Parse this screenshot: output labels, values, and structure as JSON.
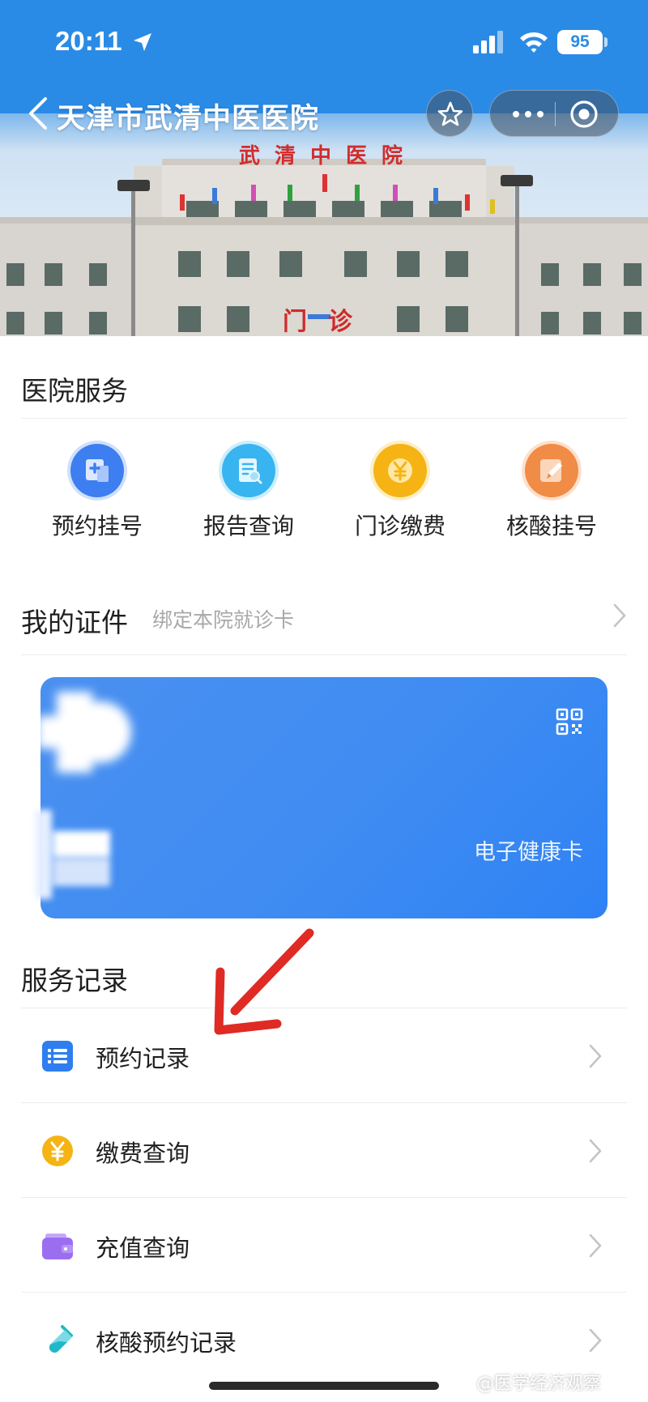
{
  "status_bar": {
    "time": "20:11",
    "battery": "95"
  },
  "nav": {
    "title": "天津市武清中医医院"
  },
  "hero": {
    "sign": "武清中医院",
    "door": "门诊"
  },
  "hospital_services": {
    "title": "医院服务",
    "items": [
      {
        "label": "预约挂号",
        "icon": "appointment-icon",
        "color": "#3d7ef0"
      },
      {
        "label": "报告查询",
        "icon": "report-icon",
        "color": "#38b4f0"
      },
      {
        "label": "门诊缴费",
        "icon": "yuan-icon",
        "color": "#f5b414"
      },
      {
        "label": "核酸挂号",
        "icon": "pencil-icon",
        "color": "#f08c46"
      }
    ]
  },
  "certificates": {
    "title": "我的证件",
    "subtitle": "绑定本院就诊卡",
    "card_label": "电子健康卡"
  },
  "service_records": {
    "title": "服务记录",
    "items": [
      {
        "label": "预约记录",
        "icon": "list-icon",
        "color": "#2f7ef0"
      },
      {
        "label": "缴费查询",
        "icon": "yuan-coin-icon",
        "color": "#f5b414"
      },
      {
        "label": "充值查询",
        "icon": "wallet-icon",
        "color": "#9b6ef0"
      },
      {
        "label": "核酸预约记录",
        "icon": "test-tube-icon",
        "color": "#20b8c8"
      }
    ]
  },
  "watermark": "@医学经济观察",
  "colors": {
    "accent": "#2f82f4",
    "status_blue": "#2a8be6",
    "annotation_red": "#e02a24"
  }
}
